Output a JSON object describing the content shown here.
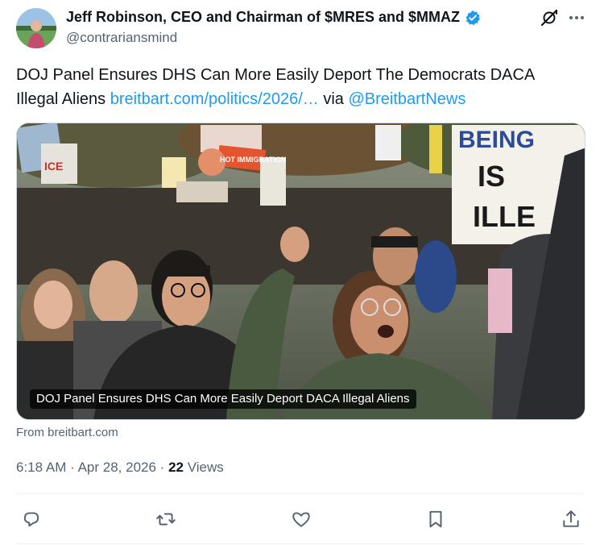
{
  "author": {
    "display_name": "Jeff Robinson, CEO and Chairman of $MRES and $MMAZ",
    "handle": "@contrariansmind",
    "verified": true
  },
  "tweet": {
    "text_main": "DOJ Panel Ensures DHS Can More Easily Deport The Democrats DACA Illegal Aliens",
    "link_text": "breitbart.com/politics/2026/…",
    "via_text": "via",
    "mention": "@BreitbartNews"
  },
  "media": {
    "caption": "DOJ Panel Ensures DHS Can More Easily Deport DACA Illegal Aliens",
    "sign_texts": [
      "BEING",
      "IS",
      "ILLE",
      "ICE",
      "HOT IMMIGRATION"
    ]
  },
  "card_source": "From breitbart.com",
  "meta": {
    "time": "6:18 AM",
    "separator": "·",
    "date": "Apr 28, 2026",
    "views_count": "22",
    "views_label": "Views"
  },
  "icons": {
    "grok": "grok-icon",
    "more": "more-icon",
    "reply": "reply-icon",
    "retweet": "retweet-icon",
    "like": "like-icon",
    "bookmark": "bookmark-icon",
    "share": "share-icon"
  },
  "colors": {
    "link": "#1d9bf0",
    "verified": "#1d9bf0",
    "secondary_text": "#536471",
    "primary_text": "#0f1419"
  }
}
